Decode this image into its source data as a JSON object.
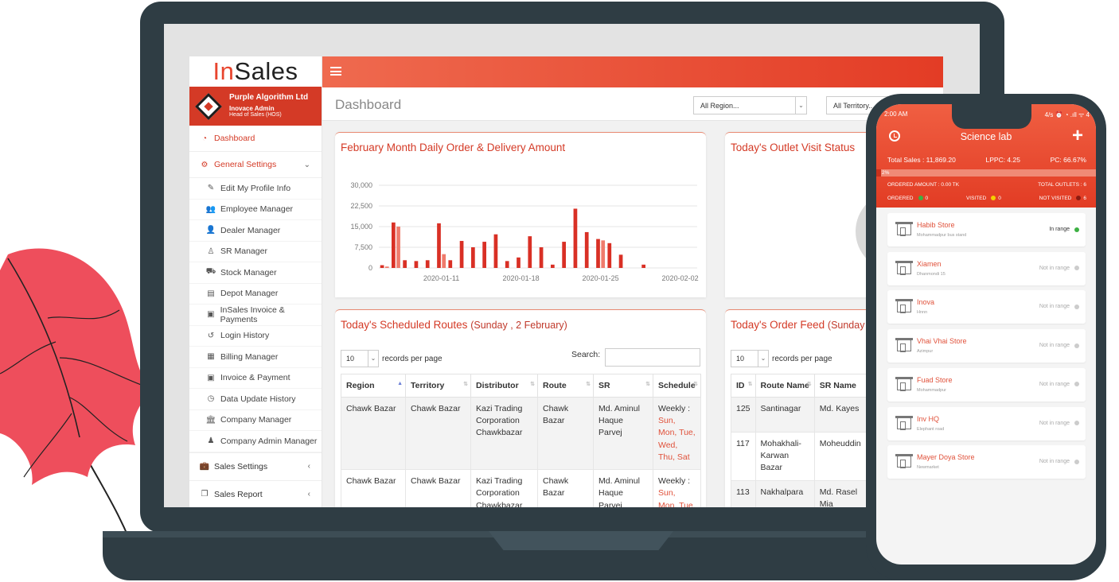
{
  "app": {
    "logo_in": "In",
    "logo_sales": "Sales",
    "profile": {
      "company": "Purple Algorithm Ltd",
      "role": "Inovace Admin",
      "position": "Head of Sales (HOS)"
    },
    "menu": {
      "dashboard": "Dashboard",
      "general_settings": "General Settings",
      "sub_items": [
        "Edit My Profile Info",
        "Employee Manager",
        "Dealer Manager",
        "SR Manager",
        "Stock Manager",
        "Depot Manager",
        "InSales Invoice & Payments",
        "Login History",
        "Billing Manager",
        "Invoice & Payment",
        "Data Update History",
        "Company Manager",
        "Company Admin Manager"
      ],
      "sales_settings": "Sales Settings",
      "sales_report": "Sales Report"
    },
    "header": {
      "title": "Dashboard",
      "region_select": "All Region...",
      "territory_select": "All Territory..."
    },
    "order_chart_card": {
      "title": "February Month Daily Order & Delivery Amount"
    },
    "outlet_card": {
      "title": "Today's Outlet Visit Status"
    },
    "routes_card": {
      "title": "Today's Scheduled Routes",
      "date": "(Sunday , 2 February)",
      "length_value": "10",
      "length_text": "records per page",
      "search_label": "Search:",
      "columns": [
        "Region",
        "Territory",
        "Distributor",
        "Route",
        "SR",
        "Schedule"
      ],
      "rows": [
        {
          "region": "Chawk Bazar",
          "territory": "Chawk Bazar",
          "distributor": "Kazi Trading Corporation Chawkbazar",
          "route": "Chawk Bazar",
          "sr": "Md. Aminul Haque Parvej",
          "schedule_label": "Weekly :",
          "schedule_days": "Sun, Mon, Tue, Wed, Thu, Sat"
        },
        {
          "region": "Chawk Bazar",
          "territory": "Chawk Bazar",
          "distributor": "Kazi Trading Corporation Chawkbazar",
          "route": "Chawk Bazar",
          "sr": "Md. Aminul Haque Parvej",
          "schedule_label": "Weekly :",
          "schedule_days": "Sun, Mon, Tue, Wed, Thu, Sat"
        }
      ]
    },
    "feed_card": {
      "title": "Today's Order Feed",
      "date": "(Sunday",
      "length_value": "10",
      "length_text": "records per page",
      "columns": [
        "ID",
        "Route Name",
        "SR Name"
      ],
      "rows": [
        {
          "id": "125",
          "route": "Santinagar",
          "sr": "Md. Kayes"
        },
        {
          "id": "117",
          "route": "Mohakhali-Karwan Bazar",
          "sr": "Moheuddin"
        },
        {
          "id": "113",
          "route": "Nakhalpara",
          "sr": "Md. Rasel Mia"
        }
      ]
    }
  },
  "chart_data": {
    "type": "bar",
    "title": "February Month Daily Order & Delivery Amount",
    "xlabel": "",
    "ylabel": "",
    "ylim": [
      0,
      30000
    ],
    "y_ticks": [
      "30,000",
      "22,500",
      "15,000",
      "7,500",
      "0"
    ],
    "x_tick_labels": [
      "2020-01-11",
      "2020-01-18",
      "2020-01-25",
      "2020-02-02"
    ],
    "x_tick_indices": [
      5,
      12,
      19,
      26
    ],
    "categories": [
      "2020-01-06",
      "2020-01-07",
      "2020-01-08",
      "2020-01-09",
      "2020-01-10",
      "2020-01-11",
      "2020-01-12",
      "2020-01-13",
      "2020-01-14",
      "2020-01-15",
      "2020-01-16",
      "2020-01-17",
      "2020-01-18",
      "2020-01-19",
      "2020-01-20",
      "2020-01-21",
      "2020-01-22",
      "2020-01-23",
      "2020-01-24",
      "2020-01-25",
      "2020-01-26",
      "2020-01-27",
      "2020-01-28",
      "2020-01-29",
      "2020-01-30",
      "2020-01-31",
      "2020-02-01",
      "2020-02-02"
    ],
    "series": [
      {
        "color": "#d93025",
        "values": [
          1000,
          16500,
          2800,
          2500,
          2800,
          16200,
          2800,
          9800,
          7500,
          9500,
          12200,
          2500,
          3800,
          11500,
          7500,
          1200,
          9500,
          21500,
          13000,
          10500,
          9000,
          4800,
          0,
          1200
        ]
      },
      {
        "color": "#ef7b6c",
        "values": [
          500,
          15000,
          0,
          0,
          0,
          5000,
          0,
          0,
          0,
          0,
          0,
          0,
          0,
          0,
          0,
          0,
          0,
          0,
          0,
          10000,
          0,
          0,
          0,
          0
        ]
      }
    ]
  },
  "phone": {
    "status_time": "2:00 AM",
    "status_right": "4/s ⏰ ◔ .ıll ᯤ 4",
    "title": "Science lab",
    "total_sales": "Total Sales : 11,869.20",
    "lppc": "LPPC: 4.25",
    "pc": "PC: 66.67%",
    "progress_label": "2%",
    "progress": 0.02,
    "ordered_amount": "ORDERED AMOUNT : 0.00 TK",
    "total_outlets": "TOTAL OUTLETS : 6",
    "ordered": "ORDERED",
    "ordered_count": "0",
    "visited": "VISITED",
    "visited_count": "0",
    "not_visited": "NOT VISITED",
    "not_visited_count": "6",
    "colors": {
      "ordered": "#3cb043",
      "visited": "#f4d000",
      "not_visited": "#8b1a10"
    },
    "stores": [
      {
        "name": "Habib Store",
        "address": "Mohammadpur bus stand",
        "range": "In range",
        "in_range": true
      },
      {
        "name": "Xiamen",
        "address": "Dhanmondi 15",
        "range": "Not in range",
        "in_range": false
      },
      {
        "name": "Inova",
        "address": "Hnnn",
        "range": "Not in range",
        "in_range": false
      },
      {
        "name": "Vhai Vhai Store",
        "address": "Azimpur",
        "range": "Not in range",
        "in_range": false
      },
      {
        "name": "Fuad Store",
        "address": "Mohammadpur",
        "range": "Not in range",
        "in_range": false
      },
      {
        "name": "Inv HQ",
        "address": "Elephant road",
        "range": "Not in range",
        "in_range": false
      },
      {
        "name": "Mayer Doya Store",
        "address": "Newmarket",
        "range": "Not in range",
        "in_range": false
      }
    ]
  }
}
